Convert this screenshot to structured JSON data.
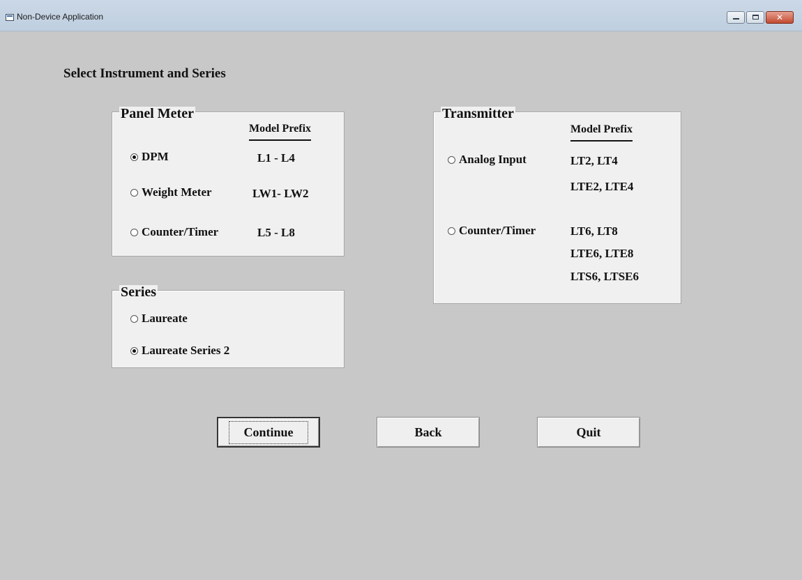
{
  "window": {
    "title": "Non-Device Application"
  },
  "heading": "Select Instrument and Series",
  "panel_meter": {
    "legend": "Panel Meter",
    "column_header": "Model Prefix",
    "options": [
      {
        "label": "DPM",
        "prefix": "L1 - L4",
        "checked": true
      },
      {
        "label": "Weight Meter",
        "prefix": "LW1- LW2",
        "checked": false
      },
      {
        "label": "Counter/Timer",
        "prefix": "L5 - L8",
        "checked": false
      }
    ]
  },
  "transmitter": {
    "legend": "Transmitter",
    "column_header": "Model Prefix",
    "options": [
      {
        "label": "Analog Input",
        "prefixes": [
          "LT2, LT4",
          "LTE2, LTE4"
        ],
        "checked": false
      },
      {
        "label": "Counter/Timer",
        "prefixes": [
          "LT6, LT8",
          "LTE6, LTE8",
          "LTS6, LTSE6"
        ],
        "checked": false
      }
    ]
  },
  "series": {
    "legend": "Series",
    "options": [
      {
        "label": "Laureate",
        "checked": false
      },
      {
        "label": "Laureate Series 2",
        "checked": true
      }
    ]
  },
  "buttons": {
    "continue": "Continue",
    "back": "Back",
    "quit": "Quit"
  }
}
